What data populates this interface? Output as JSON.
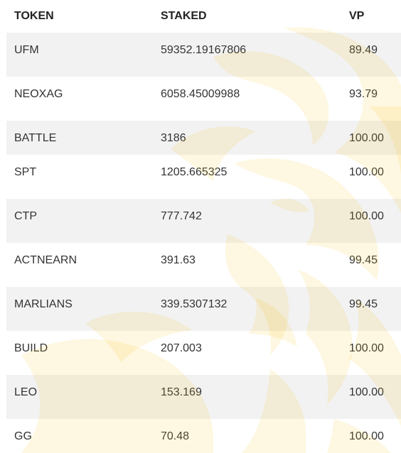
{
  "table": {
    "headers": {
      "token": "TOKEN",
      "staked": "STAKED",
      "vp": "VP"
    },
    "rows": [
      {
        "token": "UFM",
        "staked": "59352.19167806",
        "vp": "89.49"
      },
      {
        "token": "NEOXAG",
        "staked": "6058.45009988",
        "vp": "93.79"
      },
      {
        "token": "BATTLE",
        "staked": "3186",
        "vp": "100.00"
      },
      {
        "token": "SPT",
        "staked": "1205.665325",
        "vp": "100.00"
      },
      {
        "token": "CTP",
        "staked": "777.742",
        "vp": "100.00"
      },
      {
        "token": "ACTNEARN",
        "staked": "391.63",
        "vp": "99.45"
      },
      {
        "token": "MARLIANS",
        "staked": "339.5307132",
        "vp": "99.45"
      },
      {
        "token": "BUILD",
        "staked": "207.003",
        "vp": "100.00"
      },
      {
        "token": "LEO",
        "staked": "153.169",
        "vp": "100.00"
      },
      {
        "token": "GG",
        "staked": "70.48",
        "vp": "100.00"
      }
    ]
  },
  "colors": {
    "row_shade": "#f2f2f2",
    "watermark": "#f5c518"
  },
  "icons": {
    "watermark": "lion-head-logo-icon"
  }
}
